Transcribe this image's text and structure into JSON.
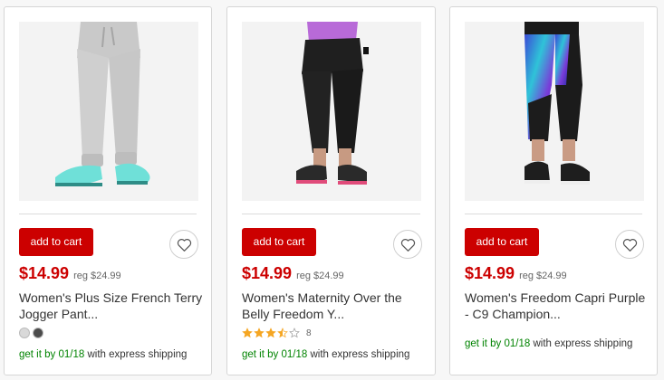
{
  "products": [
    {
      "image_alt": "",
      "add_to_cart_label": "add to cart",
      "price": "$14.99",
      "reg_price": "reg $24.99",
      "title": "Women's Plus Size French Terry Jogger Pant...",
      "swatch_colors": [
        "#d9d9d9",
        "#4b4b4b"
      ],
      "shipping_prefix": "get it by",
      "shipping_date": "01/18",
      "shipping_suffix": "with express shipping"
    },
    {
      "image_alt": "",
      "add_to_cart_label": "add to cart",
      "price": "$14.99",
      "reg_price": "reg $24.99",
      "title": "Women's Maternity Over the Belly Freedom Y...",
      "rating": 3.5,
      "rating_count": "8",
      "shipping_prefix": "get it by",
      "shipping_date": "01/18",
      "shipping_suffix": "with express shipping"
    },
    {
      "image_alt": "",
      "add_to_cart_label": "add to cart",
      "price": "$14.99",
      "reg_price": "reg $24.99",
      "title": "Women's Freedom Capri Purple - C9 Champion...",
      "shipping_prefix": "get it by",
      "shipping_date": "01/18",
      "shipping_suffix": "with express shipping"
    }
  ],
  "colors": {
    "accent_red": "#cc0000",
    "shipping_green": "#008300",
    "star_gold": "#f5a623"
  },
  "icons": {
    "favorite": "heart-outline-icon",
    "rating_star": "star-icon"
  }
}
